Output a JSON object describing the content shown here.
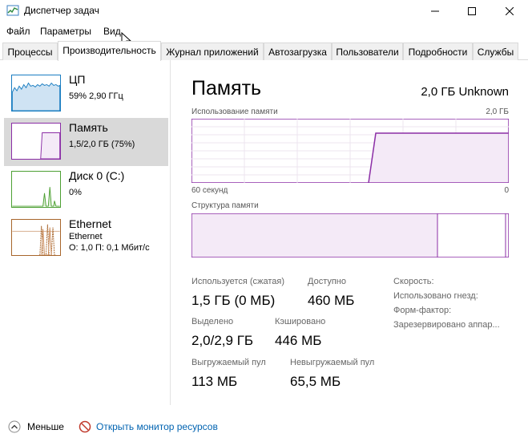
{
  "window": {
    "title": "Диспетчер задач"
  },
  "menu": [
    "Файл",
    "Параметры",
    "Вид"
  ],
  "tabs": [
    {
      "label": "Процессы"
    },
    {
      "label": "Производительность"
    },
    {
      "label": "Журнал приложений"
    },
    {
      "label": "Автозагрузка"
    },
    {
      "label": "Пользователи"
    },
    {
      "label": "Подробности"
    },
    {
      "label": "Службы"
    }
  ],
  "resources": [
    {
      "name": "ЦП",
      "sub1": "59% 2,90 ГГц",
      "sub2": "",
      "color": "#1b7ec2"
    },
    {
      "name": "Память",
      "sub1": "1,5/2,0 ГБ (75%)",
      "sub2": "",
      "color": "#8b2ea6"
    },
    {
      "name": "Диск 0 (C:)",
      "sub1": "0%",
      "sub2": "",
      "color": "#4da033"
    },
    {
      "name": "Ethernet",
      "sub1": "Ethernet",
      "sub2": "О: 1,0 П: 0,1 Мбит/с",
      "color": "#a7652b"
    }
  ],
  "detail": {
    "title": "Память",
    "total": "2,0 ГБ Unknown",
    "usage_label": "Использование памяти",
    "usage_max": "2,0 ГБ",
    "time_left": "60 секунд",
    "time_right": "0",
    "structure_label": "Структура памяти",
    "usage_level": 0.75,
    "stats": {
      "in_use_label": "Используется (сжатая)",
      "in_use_value": "1,5 ГБ (0 МБ)",
      "available_label": "Доступно",
      "available_value": "460 МБ",
      "committed_label": "Выделено",
      "committed_value": "2,0/2,9 ГБ",
      "cached_label": "Кэшировано",
      "cached_value": "446 МБ",
      "paged_label": "Выгружаемый пул",
      "paged_value": "113 МБ",
      "nonpaged_label": "Невыгружаемый пул",
      "nonpaged_value": "65,5 МБ"
    },
    "side_labels": [
      "Скорость:",
      "Использовано гнезд:",
      "Форм-фактор:",
      "Зарезервировано аппар..."
    ]
  },
  "footer": {
    "fewer_label": "Меньше",
    "monitor_label": "Открыть монитор ресурсов"
  },
  "colors": {
    "memory": "#8b2ea6",
    "link": "#0063b1"
  },
  "icons": [
    "app-icon",
    "minimize-icon",
    "maximize-icon",
    "close-icon",
    "chevron-up-icon",
    "resource-monitor-icon",
    "cursor-icon"
  ]
}
